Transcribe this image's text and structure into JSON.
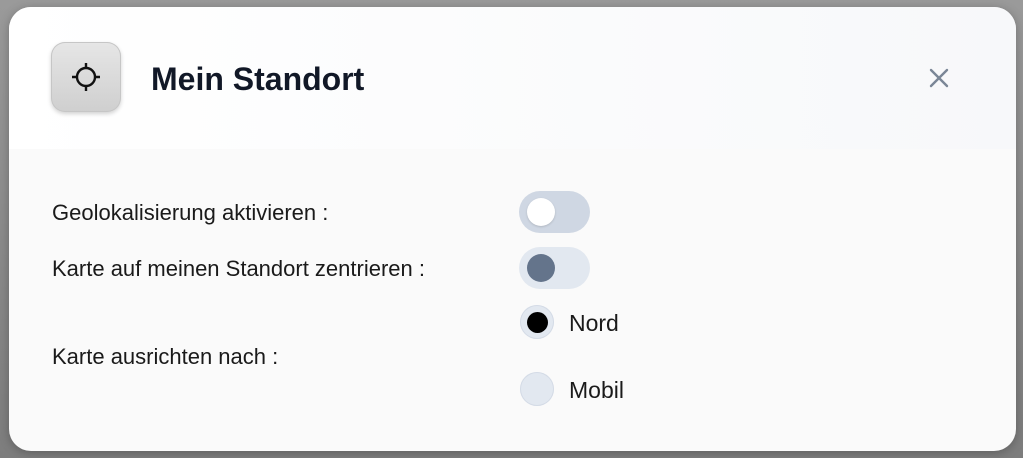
{
  "dialog": {
    "title": "Mein Standort",
    "icon": "crosshair-icon",
    "close_icon": "close-icon"
  },
  "settings": {
    "geolocation": {
      "label": "Geolokalisierung aktivieren :",
      "enabled": false
    },
    "center_map": {
      "label": "Karte auf meinen Standort zentrieren :",
      "enabled": false
    },
    "orientation": {
      "label": "Karte ausrichten nach :",
      "options": [
        {
          "label": "Nord",
          "selected": true
        },
        {
          "label": "Mobil",
          "selected": false
        }
      ]
    }
  },
  "colors": {
    "toggle_track": "#cfd7e3",
    "toggle_track_light": "#e2e8f0",
    "toggle_knob_white": "#ffffff",
    "toggle_knob_slate": "#64748b",
    "radio_bg": "#e2e8f0",
    "radio_selected": "#000000",
    "title_text": "#111827",
    "close_icon": "#7b8696"
  }
}
